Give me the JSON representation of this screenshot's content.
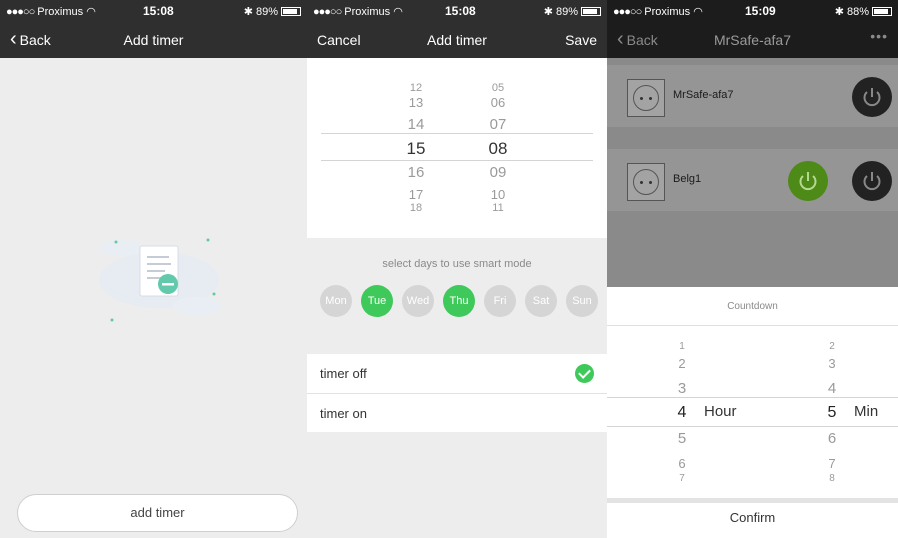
{
  "status": {
    "carrier": "Proximus",
    "p1_time": "15:08",
    "p2_time": "15:08",
    "p3_time": "15:09",
    "p1_battery": "89%",
    "p2_battery": "89%",
    "p3_battery": "88%"
  },
  "screen1": {
    "back_label": "Back",
    "title": "Add timer",
    "add_button": "add timer"
  },
  "screen2": {
    "cancel_label": "Cancel",
    "title": "Add timer",
    "save_label": "Save",
    "hours": [
      "12",
      "13",
      "14",
      "15",
      "16",
      "17",
      "18"
    ],
    "minutes": [
      "05",
      "06",
      "07",
      "08",
      "09",
      "10",
      "11"
    ],
    "selected_hour": "15",
    "selected_minute": "08",
    "days_label": "select days to use smart mode",
    "days": [
      {
        "label": "Mon",
        "active": false
      },
      {
        "label": "Tue",
        "active": true
      },
      {
        "label": "Wed",
        "active": false
      },
      {
        "label": "Thu",
        "active": true
      },
      {
        "label": "Fri",
        "active": false
      },
      {
        "label": "Sat",
        "active": false
      },
      {
        "label": "Sun",
        "active": false
      }
    ],
    "options": [
      {
        "label": "timer off",
        "checked": true
      },
      {
        "label": "timer on",
        "checked": false
      }
    ],
    "accent": "#3ec95a"
  },
  "screen3": {
    "back_label": "Back",
    "title": "MrSafe-afa7",
    "more": "•••",
    "devices": [
      {
        "name": "MrSafe-afa7"
      },
      {
        "name": "Belg1"
      }
    ],
    "countdown_title": "Countdown",
    "hours": [
      "1",
      "2",
      "3",
      "4",
      "5",
      "6",
      "7"
    ],
    "minutes": [
      "2",
      "3",
      "4",
      "5",
      "6",
      "7",
      "8"
    ],
    "selected_hour": "4",
    "selected_minute": "5",
    "hour_unit": "Hour",
    "min_unit": "Min",
    "confirm_label": "Confirm",
    "power_green": "#4e8a18"
  }
}
